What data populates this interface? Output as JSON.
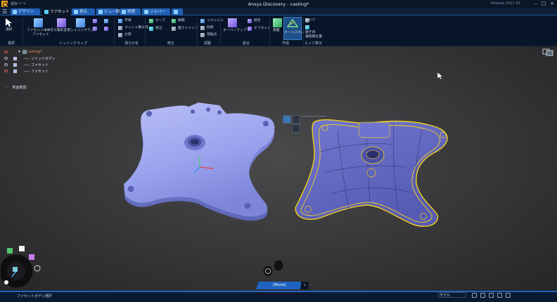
{
  "window": {
    "title": "Ansys Discovery - casting*",
    "release": "Release 2021 R2",
    "qat": "保存 ↶ ↷"
  },
  "tabs": [
    {
      "label": "デザイン",
      "icon": "design-icon"
    },
    {
      "label": "ファセット",
      "icon": "facet-icon",
      "active": true
    },
    {
      "label": "表示",
      "icon": "display-icon"
    },
    {
      "label": "ビュー調整",
      "icon": "view-icon"
    },
    {
      "label": "修理",
      "icon": "repair-icon"
    },
    {
      "label": "ソルバー",
      "icon": "solver-icon"
    },
    {
      "label": "",
      "icon": "extra-icon"
    }
  ],
  "ribbon": {
    "select": {
      "label": "選択"
    },
    "facet_convert": {
      "label1": "ファセット本体を",
      "label2": "ファセット"
    },
    "subdivide": {
      "label": "三角形変更"
    },
    "shrinkwrap": {
      "label": "シュリンクラップ"
    },
    "smooth_col": [
      "平滑",
      "メッシュ再分割",
      "分割"
    ],
    "fix_col1": [
      "カーブ",
      "修正"
    ],
    "fix_col2": [
      "展開",
      "面ストリップ"
    ],
    "adjust_col": [
      "リメッシュ",
      "削除",
      "逆転化"
    ],
    "overlap": {
      "label": "オーバーラップ"
    },
    "combine_col": [
      "結合",
      "オフセット"
    ],
    "skin_label": "表面",
    "auto_skin": {
      "label": "オートスキン"
    },
    "edge_col": [
      "エッジ",
      "継ぎ目",
      "連続縁位置"
    ],
    "group_labels": {
      "select": "選択",
      "shrink": "シュリンクラップ",
      "smooth": "滑らか化",
      "fix": "修正",
      "adjust": "調整",
      "combine": "結合",
      "create": "作成",
      "edge_display": "エッジ表示"
    }
  },
  "tree": {
    "root": "casting*",
    "items": [
      "ソリッドボディ",
      "ファセット",
      "ファセット"
    ],
    "section": "断面範囲"
  },
  "command": {
    "label": "(None)"
  },
  "status": {
    "text": "ファセットボディ選択",
    "field": "モデル"
  },
  "colors": {
    "accent": "#1f63c0",
    "facet_body": "#9ea6f0",
    "edge_highlight": "#f2d21c"
  }
}
